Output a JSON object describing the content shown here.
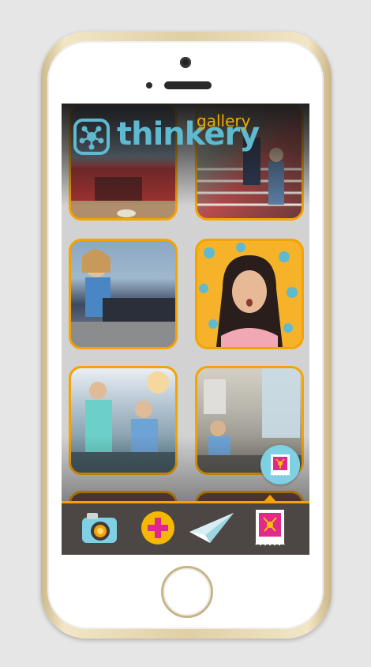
{
  "app": {
    "brand": "thinkery",
    "section": "gallery",
    "accent_color": "#f5a300",
    "brand_color": "#5fb9cf"
  },
  "gallery": {
    "photos": [
      {
        "subject": "building exterior"
      },
      {
        "subject": "family on stairs"
      },
      {
        "subject": "child at exhibit"
      },
      {
        "subject": "girl portrait with pattern background"
      },
      {
        "subject": "children at exhibit"
      },
      {
        "subject": "child at water exhibit"
      },
      {
        "subject": "photo partially visible"
      },
      {
        "subject": "photo partially visible"
      }
    ]
  },
  "tabbar": {
    "items": [
      {
        "icon": "camera-icon"
      },
      {
        "icon": "plus-icon"
      },
      {
        "icon": "paper-plane-icon"
      },
      {
        "icon": "gallery-stamp-icon",
        "selected": true
      }
    ]
  }
}
